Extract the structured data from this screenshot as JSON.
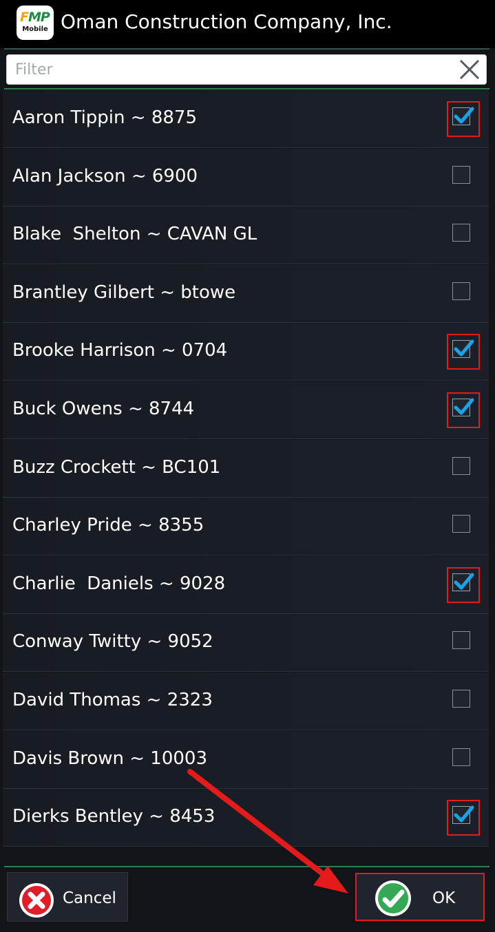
{
  "app": {
    "logo_brand_f": "F",
    "logo_brand_mp": "MP",
    "logo_subtitle": "Mobile",
    "company_title": "Oman Construction Company, Inc."
  },
  "filter": {
    "value": "",
    "placeholder": "Filter",
    "clear_icon": "close-icon"
  },
  "list": {
    "items": [
      {
        "label": "Aaron Tippin ~ 8875",
        "checked": true,
        "highlighted": true
      },
      {
        "label": "Alan Jackson ~ 6900",
        "checked": false,
        "highlighted": false
      },
      {
        "label": "Blake  Shelton ~ CAVAN GL",
        "checked": false,
        "highlighted": false
      },
      {
        "label": "Brantley Gilbert ~ btowe",
        "checked": false,
        "highlighted": false
      },
      {
        "label": "Brooke Harrison ~ 0704",
        "checked": true,
        "highlighted": true
      },
      {
        "label": "Buck Owens ~ 8744",
        "checked": true,
        "highlighted": true
      },
      {
        "label": "Buzz Crockett ~ BC101",
        "checked": false,
        "highlighted": false
      },
      {
        "label": "Charley Pride ~ 8355",
        "checked": false,
        "highlighted": false
      },
      {
        "label": "Charlie  Daniels ~ 9028",
        "checked": true,
        "highlighted": true
      },
      {
        "label": "Conway Twitty ~ 9052",
        "checked": false,
        "highlighted": false
      },
      {
        "label": "David Thomas ~ 2323",
        "checked": false,
        "highlighted": false
      },
      {
        "label": "Davis Brown ~ 10003",
        "checked": false,
        "highlighted": false
      },
      {
        "label": "Dierks Bentley ~ 8453",
        "checked": true,
        "highlighted": true
      }
    ]
  },
  "footer": {
    "cancel_label": "Cancel",
    "ok_label": "OK",
    "cancel_icon": "red-x-icon",
    "ok_icon": "green-check-icon",
    "ok_highlighted": true
  },
  "colors": {
    "background": "#111418",
    "title_bar": "#000000",
    "accent_green": "#2e7d4b",
    "checkbox_blue": "#1aa3e8",
    "highlight_red": "#e51b1b"
  }
}
